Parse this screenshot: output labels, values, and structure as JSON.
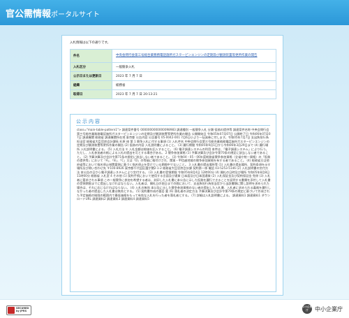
{
  "header": {
    "site_title": "官公需情報",
    "site_subtitle": "ポータルサイト",
    "color": "#2b97d8"
  },
  "intro_text": "入札情報は以下の通りです。",
  "table": {
    "rows": [
      {
        "label": "件名",
        "value": "中央会問行会第三号総合業務務電話施所ガスターピンエンジンの定期及び観測装置等更所作業の開告"
      },
      {
        "label": "入札区分",
        "value": "一般競争入札"
      },
      {
        "label": "公示日または更新日",
        "value": "2023 年 7 月 7 日"
      },
      {
        "label": "組織",
        "value": "総務省"
      },
      {
        "label": "取得日",
        "value": "2023 年 7 月 7 日 20:13:21"
      }
    ],
    "label_bg": "#d9efd4"
  },
  "content": {
    "title": "公示内容",
    "body": "class=\"main-table-pattern1\"> 調達案件番号 0000000000000098983 調達種別 一般競争入札 分類 役務の提供等 調達案件名称 中央会問行会第三号総合業務務電話施所ガスターピンエンジンの定期及び観測装置等更所作業の開告 公開開始日 令和05年07月07日 公開終了日 令和06年07月07日 調達機関 総務省 調達機関所在地 東京都 公告内容 公告番号 05-0042-001 7月6日小より一括発券に付します。令和05年7月7日 支出負担行為担当官 総務省大臣官房会計課長 杉原 修 第 1 競争入札に付する事項 (1) 入札件名 中央会問行会第三号総合業務務電話施所ガスターピンエンジンの定期及び観測装置等更所作業の開告 (2) 役務の内容 入札説明書によること。 (3) 履行期間 令和05年9月1日から令和06年3月29日まで (4) 履行場所 入札説明書による。 (5) 入札方法 ① 入札金額は総価を記入すること。 (6) 電子調達システムの利用 本件は、「電子調達システム」により行う。ただし、入札参加者の紙による入札の提出を可とする場合がある。 2 競争参加資格 (1) 予算決算及び会計令第70条の規定に該当しない者であること。 (2) 予算決算及び会計令第71条の規定に該当しない者であること。 (3) 令和04・05・06年度総務省競争参加資格（全省庁統一資格）の「役務の提供等」において「A」、「B」、「C」又は「D」の等級に格付けされ、関東・甲信越地域の競争参加資格を有する者であること。 (4) 総務省又は他府省等において指名停止措置要領に基づく指名停止を受けている期間中でないこと。 3 入札書の提出場所等 (1) 入札書の提出場所、契約条項を示す場所及び問い合わせ先 〒100-8926 東京都千代田区霞が関2-1-2 総務省大臣官房会計課 契約第一係 電話 03-5253-5146 (2) 入札説明書の交付方法 本公告の日から電子調達システムにより交付する。 (3) 入札書の受領期限 令和05年8月4日 12時00分 (4) 開札の日時及び場所 令和05年8月8日 11時00分 総務省 入札室 4 その他 (1) 契約手続において使用する言語及び通貨 日本語及び日本国通貨 (2) 入札保証金及び契約保証金 免除 (3) 入札者に要求される事項 この一般競争に参加を希望する者は、封印した入札書に本公告に示した役務を履行できることを証明する書類を添付して入札書の受領期限までに提出しなければならない。入札者は、開札日の前日までの間において、支出負担行為担当官から当該書類に関し説明を求められた場合は、それに応じなければならない。 (4) 入札の無効 本公告に示した競争参加資格のない者の提出した入札書、入札者に求められる義務を履行しなかった者の提出した入札書は無効とする。 (5) 契約書作成の要否 要 (6) 落札者の決定方法 予算決算及び会計令第79条の規定に基づいて作成された予定価格の制限の範囲内で最低価格をもって有効な入札を行った者を落札者とする。 (7) 詳細は入札説明書による。 調達資料1 調達資料1 ダウンロードURL 調達資料2 調達資料3 調達資料4 調達資料5"
  },
  "footer": {
    "badge_text": "SECURED\nby JPRS",
    "logo_mark": "中小企業庁",
    "logo_name": "中小企業庁"
  }
}
